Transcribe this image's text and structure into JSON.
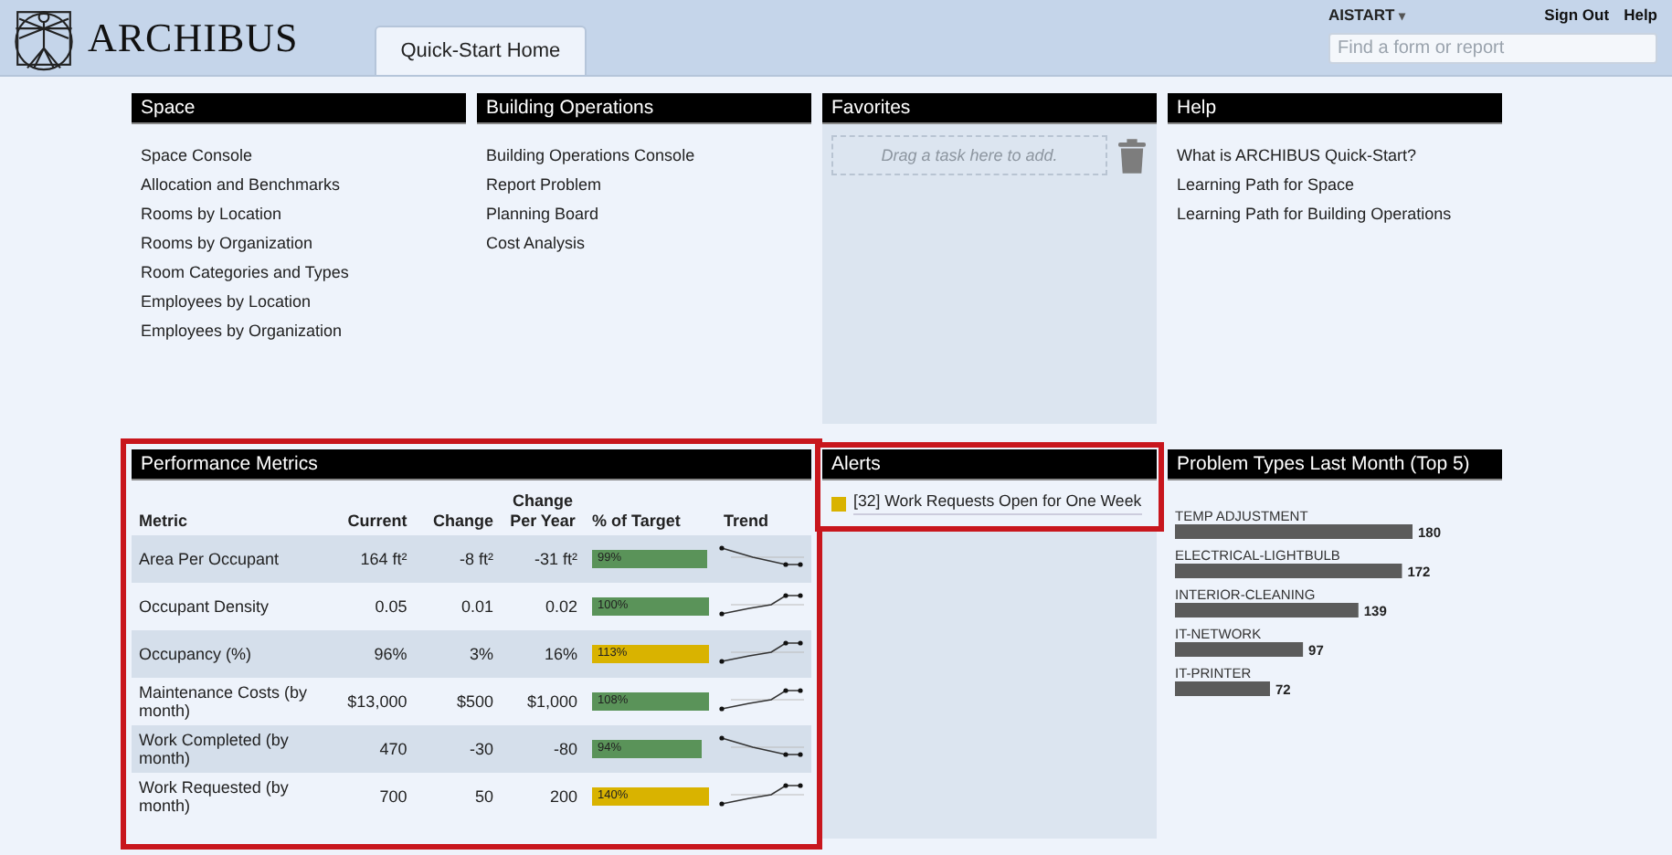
{
  "header": {
    "logo_text": "ARCHIBUS",
    "tabs": [
      {
        "label": "Quick-Start Home",
        "selected": true
      }
    ],
    "user": "AISTART",
    "user_caret": "▾",
    "links": [
      "Sign Out",
      "Help"
    ],
    "search": {
      "placeholder": "Find a form or report"
    }
  },
  "space": {
    "title": "Space",
    "items": [
      "Space Console",
      "Allocation and Benchmarks",
      "Rooms by Location",
      "Rooms by Organization",
      "Room Categories and Types",
      "Employees by Location",
      "Employees by Organization"
    ]
  },
  "building_operations": {
    "title": "Building Operations",
    "items": [
      "Building Operations Console",
      "Report Problem",
      "Planning Board",
      "Cost Analysis"
    ]
  },
  "favorites": {
    "title": "Favorites",
    "drop_hint": "Drag a task here to add."
  },
  "help": {
    "title": "Help",
    "items": [
      "What is ARCHIBUS Quick-Start?",
      "Learning Path for Space",
      "Learning Path for Building Operations"
    ]
  },
  "performance_metrics": {
    "title": "Performance Metrics",
    "highlighted": true,
    "columns": [
      "Metric",
      "Current",
      "Change",
      "Change Per Year",
      "% of Target",
      "Trend"
    ],
    "rows": [
      {
        "metric": "Area Per Occupant",
        "current": "164 ft²",
        "change": "-8 ft²",
        "change_per_year": "-31 ft²",
        "target": "99%",
        "level": 0.99,
        "color": "#5a9359",
        "kind": "down"
      },
      {
        "metric": "Occupant Density",
        "current": "0.05",
        "change": "0.01",
        "change_per_year": "0.02",
        "target": "100%",
        "level": 1,
        "color": "#5a9359",
        "kind": "up"
      },
      {
        "metric": "Occupancy (%)",
        "current": "96%",
        "change": "3%",
        "change_per_year": "16%",
        "target": "113%",
        "level": 1,
        "color": "#d9b300",
        "kind": "up"
      },
      {
        "metric": "Maintenance Costs (by month)",
        "current": "$13,000",
        "change": "$500",
        "change_per_year": "$1,000",
        "target": "108%",
        "level": 1,
        "color": "#5a9359",
        "kind": "up"
      },
      {
        "metric": "Work Completed (by month)",
        "current": "470",
        "change": "-30",
        "change_per_year": "-80",
        "target": "94%",
        "level": 0.94,
        "color": "#5a9359",
        "kind": "down"
      },
      {
        "metric": "Work Requested (by month)",
        "current": "700",
        "change": "50",
        "change_per_year": "200",
        "target": "140%",
        "level": 1,
        "color": "#d9b300",
        "kind": "up"
      }
    ]
  },
  "alerts": {
    "title": "Alerts",
    "highlighted": true,
    "items": [
      {
        "text": "[32] Work Requests Open for One Week",
        "color": "#d9b300"
      }
    ]
  },
  "problem_types": {
    "title": "Problem Types Last Month (Top 5)",
    "chart_data": {
      "type": "bar",
      "orientation": "horizontal",
      "categories": [
        "TEMP ADJUSTMENT",
        "ELECTRICAL-LIGHTBULB",
        "INTERIOR-CLEANING",
        "IT-NETWORK",
        "IT-PRINTER"
      ],
      "values": [
        180,
        172,
        139,
        97,
        72
      ],
      "data_labels": true
    }
  }
}
